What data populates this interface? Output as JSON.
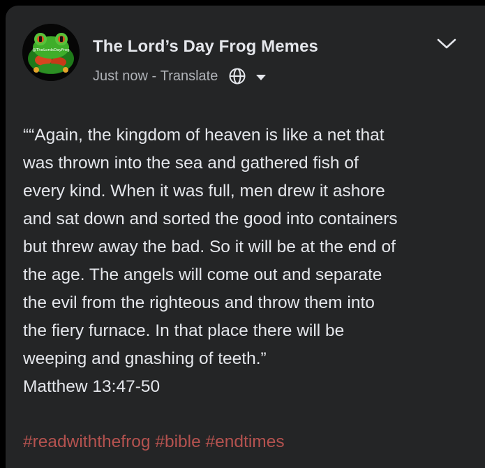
{
  "post": {
    "author": "The Lord’s Day Frog Memes",
    "avatar_text": "@TheLordsDayFrog",
    "timestamp": "Just now",
    "separator": " - ",
    "translate_label": "Translate",
    "body_lines": [
      "““Again, the kingdom of heaven is like a net that",
      "was thrown into the sea and gathered fish of",
      "every kind. When it was full, men drew it ashore",
      "and sat down and sorted the good into containers",
      "but threw away the bad. So it will be at the end of",
      "the age. The angels will come out and separate",
      "the evil from the righteous and throw them into",
      "the fiery furnace. In that place there will be",
      "weeping and gnashing of teeth.”",
      "Matthew 13:47-50"
    ],
    "hashtags": [
      "#readwiththefrog",
      "#bible",
      "#endtimes"
    ],
    "icons": {
      "globe": "globe-icon",
      "audience": "caret-down-icon",
      "more": "chevron-down-icon"
    }
  },
  "colors": {
    "card_background": "#242526",
    "text_primary": "#e4e6eb",
    "text_secondary": "#b0b3b8",
    "hashtag": "#b4524f"
  }
}
